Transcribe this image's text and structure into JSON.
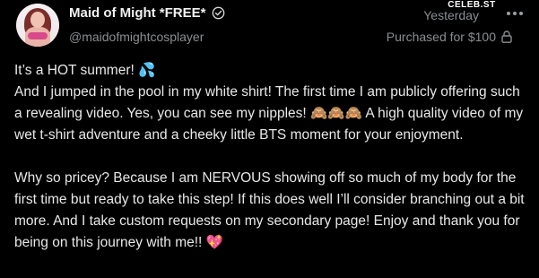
{
  "watermark": "CELEB.ST",
  "post": {
    "author": {
      "name": "Maid of Might *FREE*",
      "handle": "@maidofmightcosplayer"
    },
    "date": "Yesterday",
    "price_label": "Purchased for $100",
    "paragraphs": [
      "It’s a HOT summer! 💦",
      "And I jumped in the pool in my white shirt! The first time I am publicly offering such a revealing video. Yes, you can see my nipples! 🙈🙈🙈 A high quality video of my wet t-shirt adventure and a cheeky little BTS moment for your enjoyment.",
      "Why so pricey? Because I am NERVOUS showing off so much of my body for the first time but ready to take this step! If this does well I’ll consider branching out a bit more. And I take custom requests on my secondary page! Enjoy and thank you for being on this journey with me!! 💖"
    ]
  },
  "icons": {
    "verified": "verified-check-icon",
    "more": "more-options-icon",
    "lock": "lock-icon"
  },
  "colors": {
    "background": "#000000",
    "text": "#e8e8e8",
    "muted": "#8a8d91"
  }
}
